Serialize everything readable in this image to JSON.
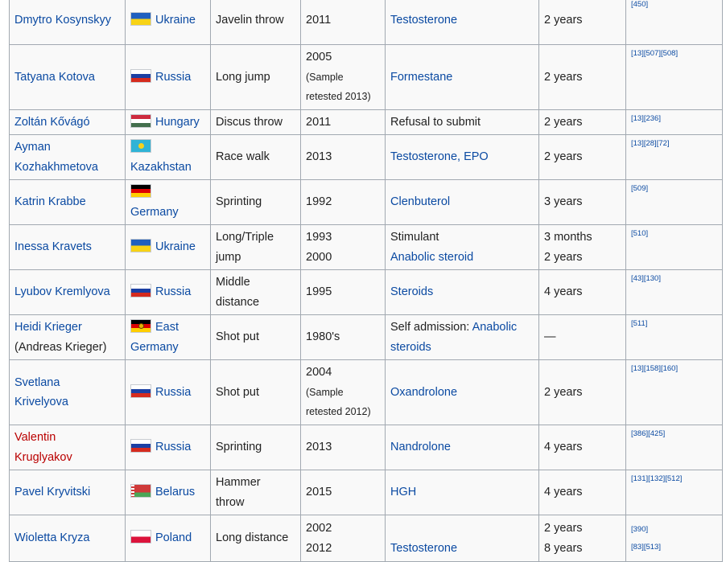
{
  "rows": [
    {
      "athlete": [
        "Dmytro Kosynskyy"
      ],
      "athlete_color": "link",
      "flag": "ukraine",
      "country": "Ukraine",
      "country_break": false,
      "event": [
        "Javelin throw"
      ],
      "year": [
        "2011"
      ],
      "substance": [
        {
          "text": "Testosterone",
          "link": true
        }
      ],
      "ban": [
        "2 years"
      ],
      "refs": [
        "[450]"
      ],
      "h": 61
    },
    {
      "athlete": [
        "Tatyana Kotova"
      ],
      "athlete_color": "link",
      "flag": "russia",
      "country": "Russia",
      "country_break": false,
      "event": [
        "Long jump"
      ],
      "year": [
        "2005",
        "(Sample",
        "retested 2013)"
      ],
      "substance": [
        {
          "text": "Formestane",
          "link": true
        }
      ],
      "ban": [
        "2 years"
      ],
      "refs": [
        "[13][507][508]"
      ],
      "h": 81
    },
    {
      "athlete": [
        "Zoltán Kővágó"
      ],
      "athlete_color": "link",
      "flag": "hungary",
      "country": "Hungary",
      "country_break": false,
      "event": [
        "Discus throw"
      ],
      "year": [
        "2011"
      ],
      "substance": [
        {
          "text": "Refusal to submit",
          "link": false
        }
      ],
      "ban": [
        "2 years"
      ],
      "refs": [
        "[13][236]"
      ],
      "h": 31
    },
    {
      "athlete": [
        "Ayman",
        "Kozhakhmetova"
      ],
      "athlete_color": "link",
      "flag": "kazakhstan",
      "country": "Kazakhstan",
      "country_break": true,
      "event": [
        "Race walk"
      ],
      "year": [
        "2013"
      ],
      "substance": [
        {
          "text": "Testosterone, EPO",
          "link": true
        }
      ],
      "ban": [
        "2 years"
      ],
      "refs": [
        "[13][28][72]"
      ],
      "h": 56
    },
    {
      "athlete": [
        "Katrin Krabbe"
      ],
      "athlete_color": "link",
      "flag": "germany",
      "country": "Germany",
      "country_break": true,
      "event": [
        "Sprinting"
      ],
      "year": [
        "1992"
      ],
      "substance": [
        {
          "text": "Clenbuterol",
          "link": true
        }
      ],
      "ban": [
        "3 years"
      ],
      "refs": [
        "[509]"
      ],
      "h": 56
    },
    {
      "athlete": [
        "Inessa Kravets"
      ],
      "athlete_color": "link",
      "flag": "ukraine",
      "country": "Ukraine",
      "country_break": false,
      "event": [
        "Long/Triple",
        "jump"
      ],
      "year": [
        "1993",
        "2000"
      ],
      "substance": [
        {
          "text": "Stimulant",
          "link": false
        },
        {
          "text": "Anabolic steroid",
          "link": true
        }
      ],
      "ban": [
        "3 months",
        "2 years"
      ],
      "refs": [
        "[510]"
      ],
      "h": 56
    },
    {
      "athlete": [
        "Lyubov Kremlyova"
      ],
      "athlete_color": "link",
      "flag": "russia",
      "country": "Russia",
      "country_break": false,
      "event": [
        "Middle",
        "distance"
      ],
      "year": [
        "1995"
      ],
      "substance": [
        {
          "text": "Steroids",
          "link": true
        }
      ],
      "ban": [
        "4 years"
      ],
      "refs": [
        "[43][130]"
      ],
      "h": 56
    },
    {
      "athlete": [
        "Heidi Krieger",
        "(Andreas Krieger)"
      ],
      "athlete_color": "mixed",
      "flag": "eastgermany",
      "country": "East Germany",
      "country_break": false,
      "event": [
        "Shot put"
      ],
      "year": [
        "1980's"
      ],
      "substance": [
        {
          "text": "Self admission: ",
          "link": false
        },
        {
          "text": "Anabolic steroids",
          "link": true
        }
      ],
      "ban": [
        "—"
      ],
      "refs": [
        "[511]"
      ],
      "h": 56
    },
    {
      "athlete": [
        "Svetlana",
        "Krivelyova"
      ],
      "athlete_color": "link",
      "flag": "russia",
      "country": "Russia",
      "country_break": false,
      "event": [
        "Shot put"
      ],
      "year": [
        "2004",
        "(Sample",
        "retested 2012)"
      ],
      "substance": [
        {
          "text": "Oxandrolone",
          "link": true
        }
      ],
      "ban": [
        "2 years"
      ],
      "refs": [
        "[13][158][160]"
      ],
      "h": 81
    },
    {
      "athlete": [
        "Valentin",
        "Kruglyakov"
      ],
      "athlete_color": "red",
      "flag": "russia",
      "country": "Russia",
      "country_break": false,
      "event": [
        "Sprinting"
      ],
      "year": [
        "2013"
      ],
      "substance": [
        {
          "text": "Nandrolone",
          "link": true
        }
      ],
      "ban": [
        "4 years"
      ],
      "refs": [
        "[386][425]"
      ],
      "h": 56
    },
    {
      "athlete": [
        "Pavel Kryvitski"
      ],
      "athlete_color": "link",
      "flag": "belarus",
      "country": "Belarus",
      "country_break": false,
      "event": [
        "Hammer",
        "throw"
      ],
      "year": [
        "2015"
      ],
      "substance": [
        {
          "text": "HGH",
          "link": true
        }
      ],
      "ban": [
        "4 years"
      ],
      "refs": [
        "[131][132][512]"
      ],
      "h": 56
    },
    {
      "athlete": [
        "Wioletta Kryza"
      ],
      "athlete_color": "link",
      "flag": "poland",
      "country": "Poland",
      "country_break": false,
      "event": [
        "Long distance"
      ],
      "year": [
        "2002",
        "2012"
      ],
      "substance": [
        {
          "text": "",
          "link": false
        },
        {
          "text": "Testosterone",
          "link": true
        }
      ],
      "ban": [
        "2 years",
        "8 years"
      ],
      "refs": [
        "[390]",
        "[83][513]"
      ],
      "h": 58
    }
  ]
}
